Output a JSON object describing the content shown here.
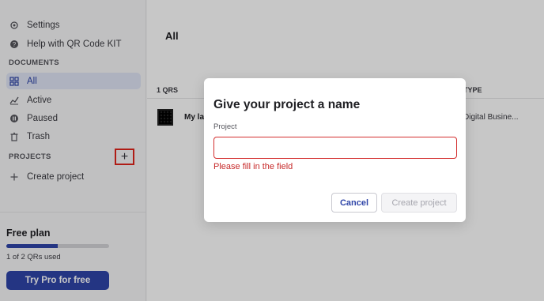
{
  "sidebar": {
    "top_items": [
      {
        "label": "Settings",
        "icon": "gear-icon"
      },
      {
        "label": "Help with QR Code KIT",
        "icon": "help-icon"
      }
    ],
    "documents_label": "DOCUMENTS",
    "documents": [
      {
        "label": "All",
        "icon": "grid-icon",
        "active": true
      },
      {
        "label": "Active",
        "icon": "chart-icon"
      },
      {
        "label": "Paused",
        "icon": "pause-icon"
      },
      {
        "label": "Trash",
        "icon": "trash-icon"
      }
    ],
    "projects_label": "PROJECTS",
    "add_project_glyph": "+",
    "create_project_label": "Create project",
    "plan": {
      "title": "Free plan",
      "used_text": "1 of 2 QRs used",
      "used_fraction": 0.5,
      "cta_label": "Try Pro for free"
    }
  },
  "main": {
    "title": "All",
    "count_label": "1 QRS",
    "type_header": "TYPE",
    "rows": [
      {
        "name": "My la",
        "type": "Digital Busine..."
      }
    ]
  },
  "modal": {
    "title": "Give your project a name",
    "field_label": "Project",
    "field_value": "",
    "field_placeholder": "",
    "error_text": "Please fill in the field",
    "cancel_label": "Cancel",
    "create_label": "Create project"
  },
  "colors": {
    "accent": "#2f45a8",
    "error": "#c62828",
    "highlight_box": "#e0241c"
  }
}
